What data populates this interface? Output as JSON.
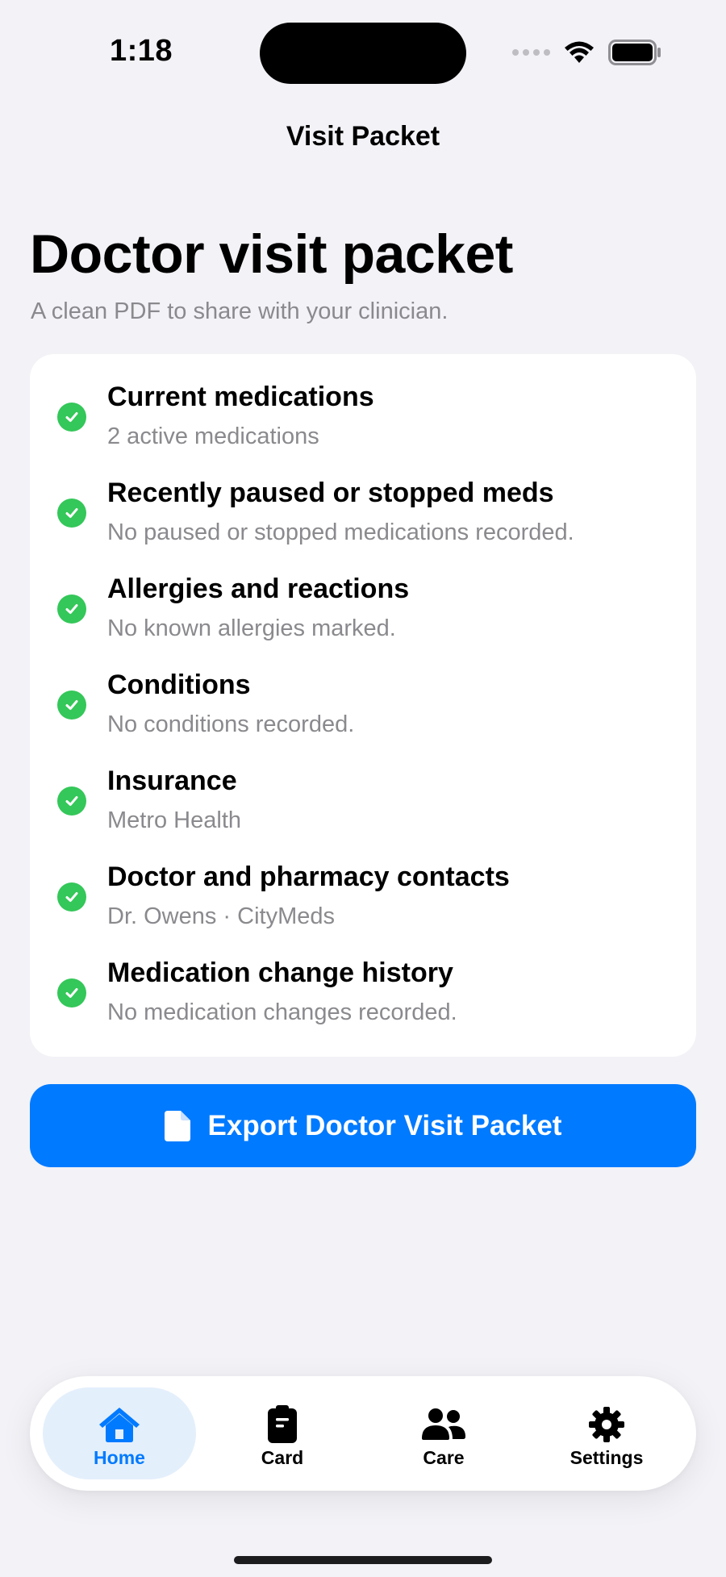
{
  "status_bar": {
    "time": "1:18"
  },
  "nav": {
    "title": "Visit Packet"
  },
  "header": {
    "title": "Doctor visit packet",
    "subtitle": "A clean PDF to share with your clinician."
  },
  "packet_items": [
    {
      "title": "Current medications",
      "detail": "2 active medications"
    },
    {
      "title": "Recently paused or stopped meds",
      "detail": "No paused or stopped medications recorded."
    },
    {
      "title": "Allergies and reactions",
      "detail": "No known allergies marked."
    },
    {
      "title": "Conditions",
      "detail": "No conditions recorded."
    },
    {
      "title": "Insurance",
      "detail": "Metro Health"
    },
    {
      "title": "Doctor and pharmacy contacts",
      "detail": "Dr. Owens · CityMeds"
    },
    {
      "title": "Medication change history",
      "detail": "No medication changes recorded."
    }
  ],
  "export_button": {
    "label": "Export Doctor Visit Packet",
    "icon": "document-icon"
  },
  "tab_bar": {
    "tabs": [
      {
        "label": "Home",
        "icon": "house-icon",
        "active": true
      },
      {
        "label": "Card",
        "icon": "clipboard-icon",
        "active": false
      },
      {
        "label": "Care",
        "icon": "people-icon",
        "active": false
      },
      {
        "label": "Settings",
        "icon": "gear-icon",
        "active": false
      }
    ]
  },
  "colors": {
    "accent": "#007AFF",
    "check": "#34C759",
    "background": "#F2F2F7",
    "secondary_text": "#8A8A8E",
    "active_tab_bg": "#E4EFFC"
  }
}
